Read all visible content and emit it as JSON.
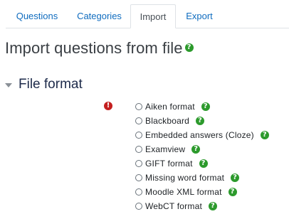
{
  "tabs": [
    {
      "label": "Questions"
    },
    {
      "label": "Categories"
    },
    {
      "label": "Import",
      "active": true
    },
    {
      "label": "Export"
    }
  ],
  "page_title": "Import questions from file",
  "help_icon_glyph": "?",
  "required_icon_glyph": "!",
  "section": {
    "title": "File format",
    "formats": [
      {
        "label": "Aiken format"
      },
      {
        "label": "Blackboard"
      },
      {
        "label": "Embedded answers (Cloze)"
      },
      {
        "label": "Examview"
      },
      {
        "label": "GIFT format"
      },
      {
        "label": "Missing word format"
      },
      {
        "label": "Moodle XML format"
      },
      {
        "label": "WebCT format"
      }
    ]
  },
  "colors": {
    "link": "#0f6cbf",
    "help": "#2c9a2c",
    "required": "#c41f1f",
    "section_title": "#1d2a4a"
  }
}
